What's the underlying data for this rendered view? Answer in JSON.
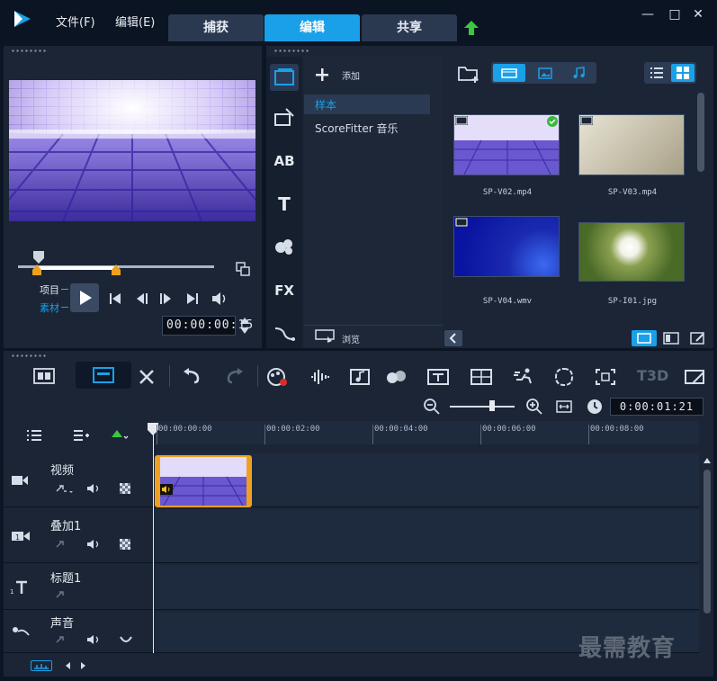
{
  "menu": {
    "file": "文件(F)",
    "edit": "编辑(E)"
  },
  "tabs": [
    {
      "label": "捕获"
    },
    {
      "label": "编辑"
    },
    {
      "label": "共享"
    }
  ],
  "window": {
    "minimize": "—",
    "maximize": "□",
    "close": "✕"
  },
  "preview": {
    "mode_project": "项目",
    "mode_clip": "素材",
    "timecode": "00:00:00:15"
  },
  "library": {
    "add_label": "添加",
    "folders": [
      {
        "label": "样本"
      },
      {
        "label": "ScoreFitter 音乐"
      }
    ],
    "browse_label": "浏览",
    "media": [
      {
        "label": "SP-V02.mp4"
      },
      {
        "label": "SP-V03.mp4"
      },
      {
        "label": "SP-V04.wmv"
      },
      {
        "label": "SP-I01.jpg"
      }
    ],
    "sidebar_fx": "FX",
    "sidebar_title": "T",
    "sidebar_ab": "AB"
  },
  "timeline": {
    "duration": "0:00:01:21",
    "ruler": [
      "00:00:00:00",
      "00:00:02:00",
      "00:00:04:00",
      "00:00:06:00",
      "00:00:08:00"
    ],
    "tracks": [
      {
        "label": "视频"
      },
      {
        "label": "叠加1"
      },
      {
        "label": "标题1"
      },
      {
        "label": "声音"
      }
    ],
    "t3d": "T3D"
  },
  "watermark": "最需教育",
  "colors": {
    "accent": "#1aa0e8",
    "panel": "#1b2536",
    "background": "#0c1524",
    "clip_border": "#f0a020"
  }
}
